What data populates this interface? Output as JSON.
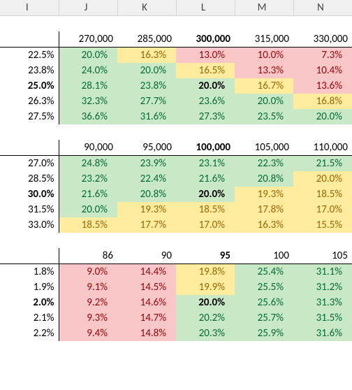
{
  "columns": {
    "I": "I",
    "J": "J",
    "K": "K",
    "L": "L",
    "M": "M",
    "N": "N"
  },
  "chart_data": [
    {
      "type": "table",
      "col_header_bold_index": 2,
      "row_label_bold_index": 2,
      "col_headers": [
        "270,000",
        "285,000",
        "300,000",
        "315,000",
        "330,000"
      ],
      "row_labels": [
        "22.5%",
        "23.8%",
        "25.0%",
        "26.3%",
        "27.5%"
      ],
      "pivot": {
        "row": 2,
        "col": 2
      },
      "cells": [
        [
          {
            "v": "20.0%",
            "c": "green"
          },
          {
            "v": "16.3%",
            "c": "yellow"
          },
          {
            "v": "13.0%",
            "c": "red"
          },
          {
            "v": "10.0%",
            "c": "red"
          },
          {
            "v": "7.3%",
            "c": "red"
          }
        ],
        [
          {
            "v": "24.0%",
            "c": "green"
          },
          {
            "v": "20.0%",
            "c": "green"
          },
          {
            "v": "16.5%",
            "c": "yellow"
          },
          {
            "v": "13.3%",
            "c": "red"
          },
          {
            "v": "10.4%",
            "c": "red"
          }
        ],
        [
          {
            "v": "28.1%",
            "c": "green"
          },
          {
            "v": "23.8%",
            "c": "green"
          },
          {
            "v": "20.0%",
            "c": "green"
          },
          {
            "v": "16.7%",
            "c": "yellow"
          },
          {
            "v": "13.6%",
            "c": "red"
          }
        ],
        [
          {
            "v": "32.3%",
            "c": "green"
          },
          {
            "v": "27.7%",
            "c": "green"
          },
          {
            "v": "23.6%",
            "c": "green"
          },
          {
            "v": "20.0%",
            "c": "green"
          },
          {
            "v": "16.8%",
            "c": "yellow"
          }
        ],
        [
          {
            "v": "36.6%",
            "c": "green"
          },
          {
            "v": "31.6%",
            "c": "green"
          },
          {
            "v": "27.3%",
            "c": "green"
          },
          {
            "v": "23.5%",
            "c": "green"
          },
          {
            "v": "20.0%",
            "c": "green"
          }
        ]
      ]
    },
    {
      "type": "table",
      "col_header_bold_index": 2,
      "row_label_bold_index": 2,
      "col_headers": [
        "90,000",
        "95,000",
        "100,000",
        "105,000",
        "110,000"
      ],
      "row_labels": [
        "27.0%",
        "28.5%",
        "30.0%",
        "31.5%",
        "33.0%"
      ],
      "pivot": {
        "row": 2,
        "col": 2
      },
      "cells": [
        [
          {
            "v": "24.8%",
            "c": "green"
          },
          {
            "v": "23.9%",
            "c": "green"
          },
          {
            "v": "23.1%",
            "c": "green"
          },
          {
            "v": "22.3%",
            "c": "green"
          },
          {
            "v": "21.5%",
            "c": "green"
          }
        ],
        [
          {
            "v": "23.2%",
            "c": "green"
          },
          {
            "v": "22.4%",
            "c": "green"
          },
          {
            "v": "21.6%",
            "c": "green"
          },
          {
            "v": "20.8%",
            "c": "green"
          },
          {
            "v": "20.0%",
            "c": "yellow"
          }
        ],
        [
          {
            "v": "21.6%",
            "c": "green"
          },
          {
            "v": "20.8%",
            "c": "green"
          },
          {
            "v": "20.0%",
            "c": "green"
          },
          {
            "v": "19.3%",
            "c": "yellow"
          },
          {
            "v": "18.5%",
            "c": "yellow"
          }
        ],
        [
          {
            "v": "20.0%",
            "c": "green"
          },
          {
            "v": "19.3%",
            "c": "yellow"
          },
          {
            "v": "18.5%",
            "c": "yellow"
          },
          {
            "v": "17.8%",
            "c": "yellow"
          },
          {
            "v": "17.0%",
            "c": "yellow"
          }
        ],
        [
          {
            "v": "18.5%",
            "c": "yellow"
          },
          {
            "v": "17.7%",
            "c": "yellow"
          },
          {
            "v": "17.0%",
            "c": "yellow"
          },
          {
            "v": "16.3%",
            "c": "yellow"
          },
          {
            "v": "15.5%",
            "c": "yellow"
          }
        ]
      ]
    },
    {
      "type": "table",
      "col_header_bold_index": 2,
      "row_label_bold_index": 2,
      "col_headers": [
        "86",
        "90",
        "95",
        "100",
        "105"
      ],
      "row_labels": [
        "1.8%",
        "1.9%",
        "2.0%",
        "2.1%",
        "2.2%"
      ],
      "pivot": {
        "row": 2,
        "col": 2
      },
      "cells": [
        [
          {
            "v": "9.0%",
            "c": "red"
          },
          {
            "v": "14.4%",
            "c": "red"
          },
          {
            "v": "19.8%",
            "c": "yellow"
          },
          {
            "v": "25.4%",
            "c": "green"
          },
          {
            "v": "31.1%",
            "c": "green"
          }
        ],
        [
          {
            "v": "9.1%",
            "c": "red"
          },
          {
            "v": "14.5%",
            "c": "red"
          },
          {
            "v": "19.9%",
            "c": "yellow"
          },
          {
            "v": "25.5%",
            "c": "green"
          },
          {
            "v": "31.2%",
            "c": "green"
          }
        ],
        [
          {
            "v": "9.2%",
            "c": "red"
          },
          {
            "v": "14.6%",
            "c": "red"
          },
          {
            "v": "20.0%",
            "c": "green"
          },
          {
            "v": "25.6%",
            "c": "green"
          },
          {
            "v": "31.3%",
            "c": "green"
          }
        ],
        [
          {
            "v": "9.3%",
            "c": "red"
          },
          {
            "v": "14.7%",
            "c": "red"
          },
          {
            "v": "20.2%",
            "c": "green"
          },
          {
            "v": "25.7%",
            "c": "green"
          },
          {
            "v": "31.5%",
            "c": "green"
          }
        ],
        [
          {
            "v": "9.4%",
            "c": "red"
          },
          {
            "v": "14.8%",
            "c": "red"
          },
          {
            "v": "20.3%",
            "c": "green"
          },
          {
            "v": "25.9%",
            "c": "green"
          },
          {
            "v": "31.6%",
            "c": "green"
          }
        ]
      ]
    }
  ]
}
